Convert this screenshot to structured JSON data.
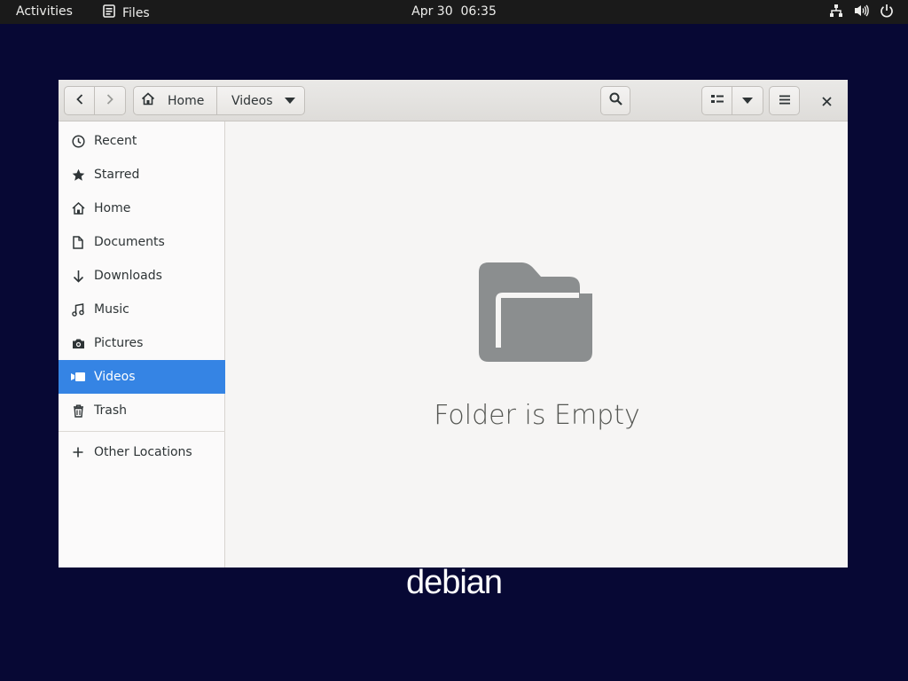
{
  "topbar": {
    "activities": "Activities",
    "app_name": "Files",
    "date": "Apr 30",
    "time": "06:35",
    "status_icons": [
      "network-icon",
      "volume-icon",
      "power-icon"
    ]
  },
  "window": {
    "headerbar": {
      "back_icon": "chevron-left-icon",
      "forward_icon": "chevron-right-icon",
      "path": [
        {
          "label": "Home",
          "icon": "home-icon"
        },
        {
          "label": "Videos",
          "icon": "caret-down-icon"
        }
      ],
      "search_icon": "search-icon",
      "view_icon": "list-view-icon",
      "view_options_icon": "caret-down-icon",
      "menu_icon": "hamburger-icon",
      "close_icon": "close-icon"
    },
    "sidebar": {
      "items": [
        {
          "label": "Recent",
          "icon": "clock-icon",
          "active": false
        },
        {
          "label": "Starred",
          "icon": "star-icon",
          "active": false
        },
        {
          "label": "Home",
          "icon": "home-icon",
          "active": false
        },
        {
          "label": "Documents",
          "icon": "document-icon",
          "active": false
        },
        {
          "label": "Downloads",
          "icon": "download-arrow-icon",
          "active": false
        },
        {
          "label": "Music",
          "icon": "music-note-icon",
          "active": false
        },
        {
          "label": "Pictures",
          "icon": "camera-icon",
          "active": false
        },
        {
          "label": "Videos",
          "icon": "video-icon",
          "active": true
        },
        {
          "label": "Trash",
          "icon": "trash-icon",
          "active": false
        }
      ],
      "other_locations": {
        "label": "Other Locations",
        "icon": "plus-icon"
      }
    },
    "content": {
      "empty_icon": "folder-icon",
      "empty_message": "Folder is Empty"
    }
  },
  "desktop": {
    "wordmark": "debian"
  },
  "colors": {
    "desktop_bg": "#070834",
    "topbar_bg": "#1a1a1a",
    "accent": "#3584e4",
    "folder_icon": "#8b8e8f"
  }
}
